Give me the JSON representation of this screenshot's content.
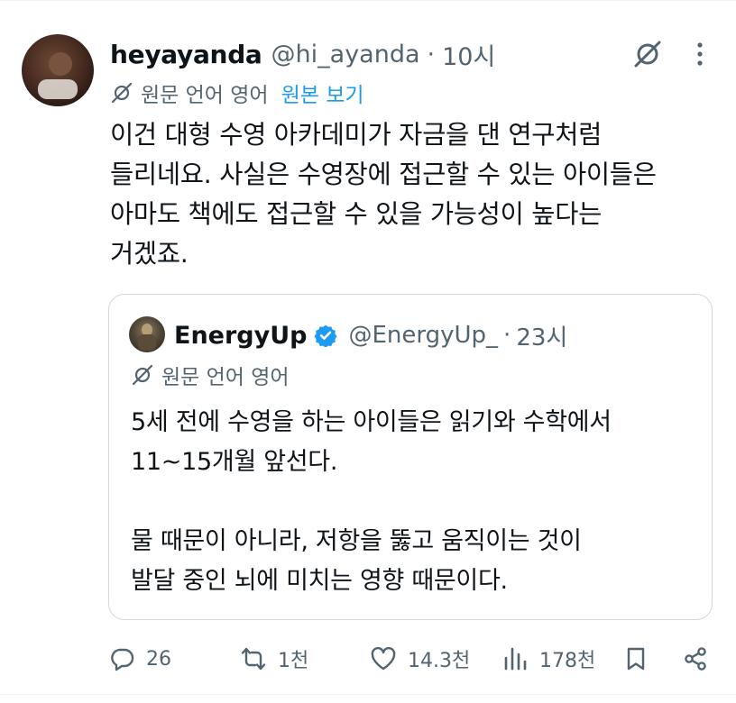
{
  "tweet": {
    "display_name": "heyayanda",
    "handle": "@hi_ayanda",
    "separator": "·",
    "time": "10시",
    "translated_label": "원문 언어 영어",
    "show_original": "원본 보기",
    "body_lines": [
      "이건 대형 수영 아카데미가 자금을 댄 연구처럼",
      "들리네요. 사실은 수영장에 접근할 수 있는 아이들은",
      "아마도 책에도 접근할 수 있을 가능성이 높다는",
      "거겠죠."
    ]
  },
  "quote": {
    "display_name": "EnergyUp",
    "handle": "@EnergyUp_",
    "separator": "·",
    "time": "23시",
    "translated_label": "원문 언어 영어",
    "body_lines": [
      "5세 전에 수영을 하는 아이들은 읽기와 수학에서",
      "11~15개월 앞선다.",
      "",
      "물 때문이 아니라, 저항을 뚫고 움직이는 것이",
      "발달 중인 뇌에 미치는 영향 때문이다."
    ]
  },
  "actions": {
    "replies": "26",
    "reposts": "1천",
    "likes": "14.3천",
    "views": "178천"
  },
  "colors": {
    "text": "#0f1419",
    "secondary": "#536471",
    "accent": "#1d9bf0",
    "border": "#cfd9de"
  },
  "icons": [
    "grok-icon",
    "more-icon",
    "translate-icon",
    "verified-icon",
    "reply-icon",
    "repost-icon",
    "like-icon",
    "views-icon",
    "bookmark-icon",
    "share-icon"
  ]
}
